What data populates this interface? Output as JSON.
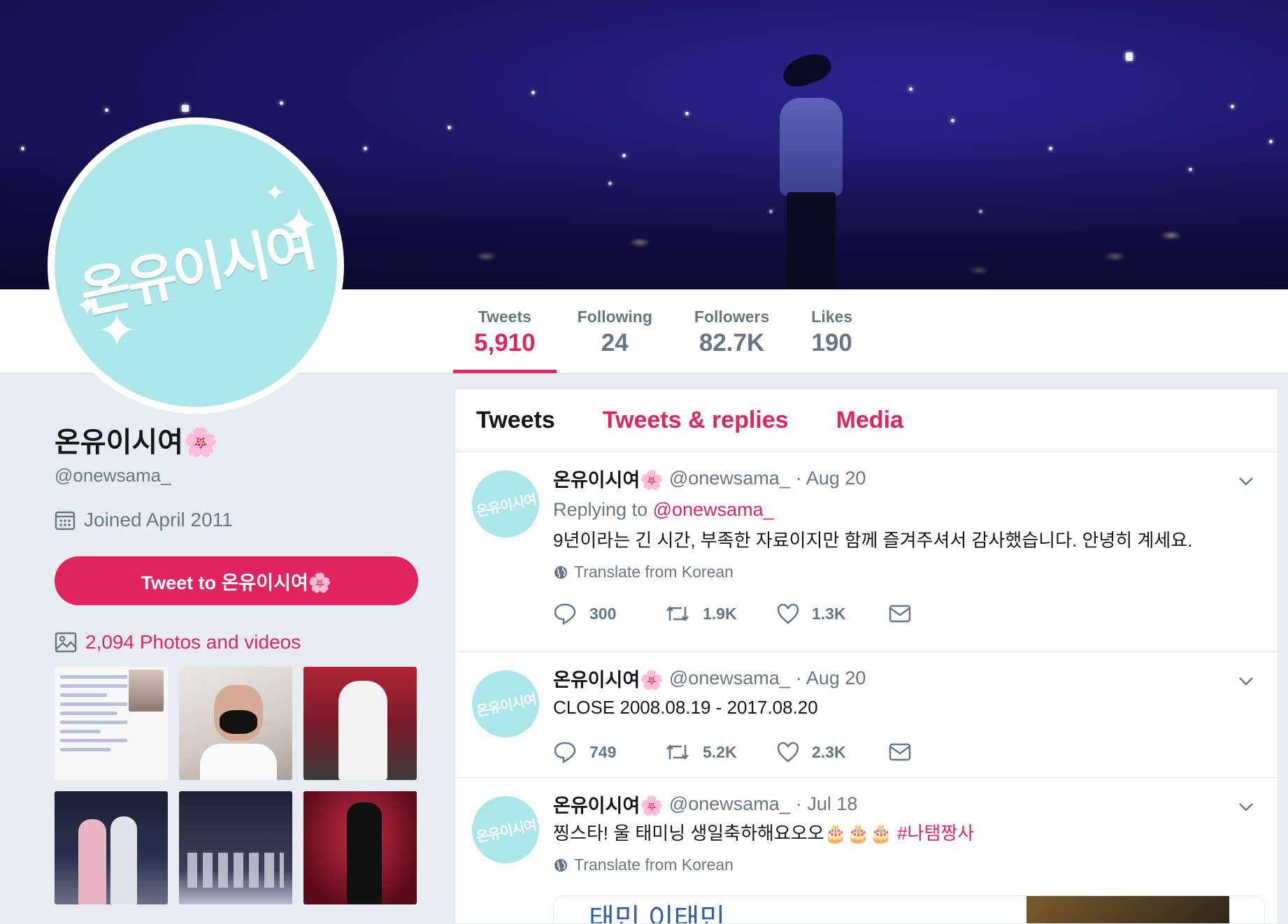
{
  "profile": {
    "name": "온유이시여🌸",
    "handle": "@onewsama_",
    "joined": "Joined April 2011",
    "tweet_to_label": "Tweet to 온유이시여🌸",
    "photos_label": "2,094 Photos and videos",
    "avatar_text": "온유이시여"
  },
  "stats": [
    {
      "label": "Tweets",
      "value": "5,910"
    },
    {
      "label": "Following",
      "value": "24"
    },
    {
      "label": "Followers",
      "value": "82.7K"
    },
    {
      "label": "Likes",
      "value": "190"
    }
  ],
  "timeline_tabs": [
    "Tweets",
    "Tweets & replies",
    "Media"
  ],
  "tweets": [
    {
      "name": "온유이시여🌸",
      "handle": "@onewsama_",
      "date": "· Aug 20",
      "reply_prefix": "Replying to",
      "reply_to": "@onewsama_",
      "text": "9년이라는 긴 시간, 부족한 자료이지만 함께 즐겨주셔서 감사했습니다. 안녕히 계세요.",
      "translate": "Translate from Korean",
      "replies": "300",
      "retweets": "1.9K",
      "likes": "1.3K"
    },
    {
      "name": "온유이시여🌸",
      "handle": "@onewsama_",
      "date": "· Aug 20",
      "text": "CLOSE 2008.08.19 - 2017.08.20",
      "replies": "749",
      "retweets": "5.2K",
      "likes": "2.3K"
    },
    {
      "name": "온유이시여🌸",
      "handle": "@onewsama_",
      "date": "· Jul 18",
      "text": "찡스타! 울 태미닝 생일축하해요오오🎂🎂🎂",
      "hashtag": "#나탬짱사",
      "translate": "Translate from Korean",
      "card_text": "태민 이태민"
    }
  ],
  "colors": {
    "accent": "#e0245e",
    "muted": "#657786",
    "avatar_bg": "#abe6e8"
  },
  "icons": [
    "calendar-icon",
    "photo-icon",
    "reply-icon",
    "retweet-icon",
    "like-icon",
    "dm-icon",
    "globe-icon",
    "chevron-down-icon"
  ]
}
